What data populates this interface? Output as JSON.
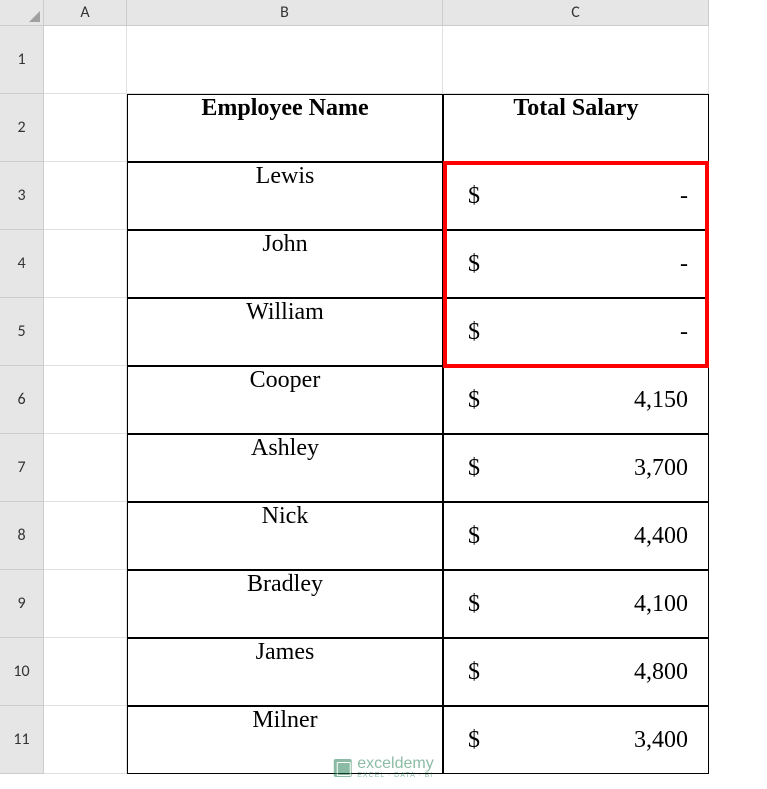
{
  "columns": {
    "a": "A",
    "b": "B",
    "c": "C"
  },
  "rows": [
    "1",
    "2",
    "3",
    "4",
    "5",
    "6",
    "7",
    "8",
    "9",
    "10",
    "11"
  ],
  "headers": {
    "name": "Employee Name",
    "salary": "Total Salary"
  },
  "currency": "$",
  "employees": [
    {
      "name": "Lewis",
      "salary": "-"
    },
    {
      "name": "John",
      "salary": "-"
    },
    {
      "name": "William",
      "salary": "-"
    },
    {
      "name": "Cooper",
      "salary": "4,150"
    },
    {
      "name": "Ashley",
      "salary": "3,700"
    },
    {
      "name": "Nick",
      "salary": "4,400"
    },
    {
      "name": "Bradley",
      "salary": "4,100"
    },
    {
      "name": "James",
      "salary": "4,800"
    },
    {
      "name": "Milner",
      "salary": "3,400"
    }
  ],
  "watermark": {
    "main": "exceldemy",
    "sub": "EXCEL · DATA · BI"
  }
}
